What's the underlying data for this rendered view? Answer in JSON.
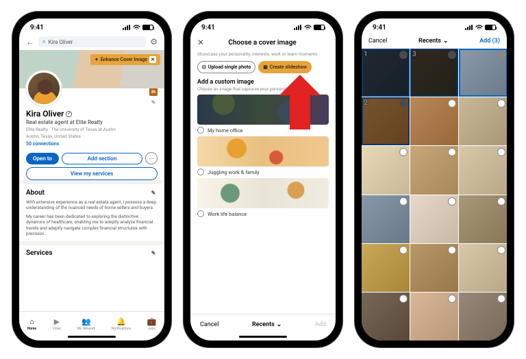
{
  "statusbar": {
    "time": "9:41"
  },
  "phone1": {
    "search_value": "Kira Oliver",
    "enhance_label": "Enhance Cover Image",
    "in_badge": "in",
    "name": "Kira Oliver",
    "headline": "Real estate agent at Elite Realty",
    "meta_line1": "Elite Realty · The University of Texas at Austin",
    "meta_line2": "Austin, Texas, United States",
    "connections": "50 connections",
    "btn_open": "Open to",
    "btn_add": "Add section",
    "btn_services": "View my services",
    "about_title": "About",
    "about_p1": "With extensive experience as a real estate agent, I possess a deep understanding of the nuanced needs of home sellers and buyers.",
    "about_p2": "My career has been dedicated to exploring the distinctive dynamics of healthcare, enabling me to adeptly analyze financial trends and adeptly navigate complex financial structures with precision.",
    "services_title": "Services",
    "tabs": {
      "home": "Home",
      "video": "Video",
      "network": "My Network",
      "notifications": "Notifications",
      "jobs": "Jobs"
    }
  },
  "phone2": {
    "title": "Choose a cover image",
    "subtitle": "Showcase your personality, interests, work or team moments",
    "pill_upload": "Upload single photo",
    "pill_create": "Create slideshow",
    "custom_title": "Add a custom image",
    "custom_sub": "Choose an image that captures your personality",
    "opt1": "My home office",
    "opt2": "Juggling work & family",
    "opt3": "Work life balance",
    "footer_cancel": "Cancel",
    "footer_recents": "Recents",
    "footer_add": "Add"
  },
  "phone3": {
    "cancel": "Cancel",
    "recents": "Recents",
    "add_label": "Add (3)",
    "selected": [
      "1",
      "2",
      "3"
    ]
  }
}
